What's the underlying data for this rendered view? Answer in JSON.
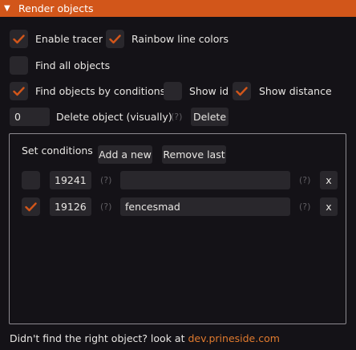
{
  "header": {
    "title": "Render objects"
  },
  "options": {
    "enable_tracer": {
      "label": "Enable tracer",
      "checked": true
    },
    "rainbow_line_colors": {
      "label": "Rainbow line colors",
      "checked": true
    },
    "find_all_objects": {
      "label": "Find all objects",
      "checked": false
    },
    "find_by_conditions": {
      "label": "Find objects by conditions",
      "checked": true
    },
    "show_id": {
      "label": "Show id",
      "checked": false
    },
    "show_distance": {
      "label": "Show distance",
      "checked": true
    }
  },
  "delete_row": {
    "value": "0",
    "label": "Delete object (visually)",
    "help": "(?)",
    "button": "Delete"
  },
  "conditions": {
    "title": "Set conditions",
    "add_button": "Add a new",
    "remove_button": "Remove last",
    "rows": [
      {
        "checked": false,
        "id": "19241",
        "id_help": "(?)",
        "name": "",
        "name_help": "(?)",
        "remove": "x"
      },
      {
        "checked": true,
        "id": "19126",
        "id_help": "(?)",
        "name": "fencesmad",
        "name_help": "(?)",
        "remove": "x"
      }
    ]
  },
  "footer": {
    "text": "Didn't find the right object? look at ",
    "link": "dev.prineside.com"
  },
  "colors": {
    "accent": "#d2561a",
    "check": "#d2561a",
    "link": "#e07a2e",
    "background": "#141217",
    "frame": "#29272c"
  },
  "icons": {
    "collapse": "triangle-down",
    "check": "checkmark"
  }
}
